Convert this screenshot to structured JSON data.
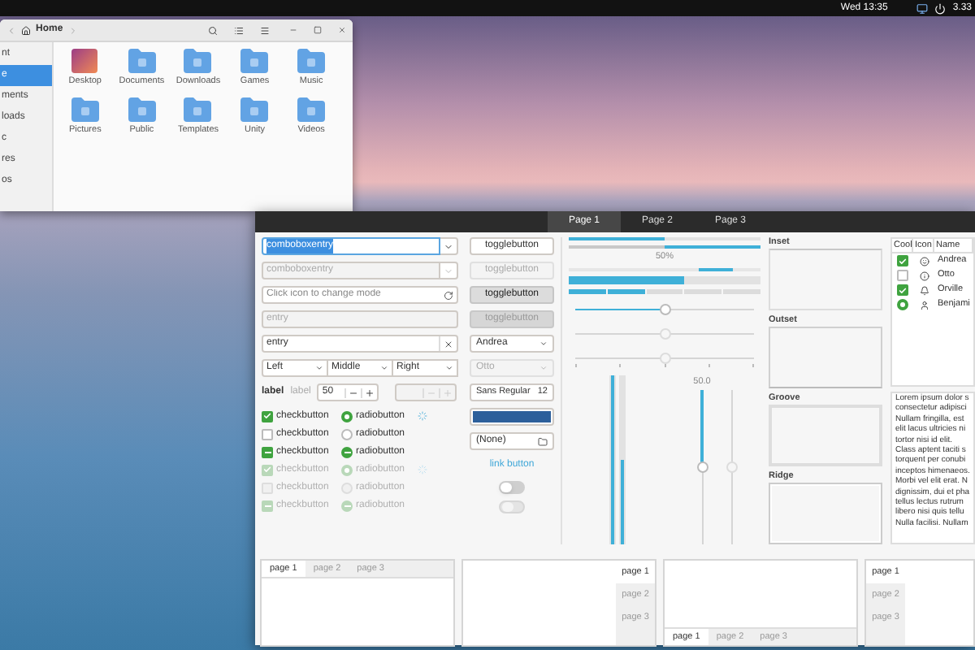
{
  "top_bar": {
    "clock": "Wed 13:35",
    "battery": "3.33"
  },
  "file_manager": {
    "title": "Home",
    "sidebar": [
      {
        "label": "nt",
        "selected": false
      },
      {
        "label": "e",
        "selected": true
      },
      {
        "label": "ments",
        "selected": false
      },
      {
        "label": "loads",
        "selected": false
      },
      {
        "label": "c",
        "selected": false
      },
      {
        "label": "res",
        "selected": false
      },
      {
        "label": "os",
        "selected": false
      }
    ],
    "files": [
      {
        "name": "Desktop",
        "kind": "desktop"
      },
      {
        "name": "Documents",
        "kind": "folder"
      },
      {
        "name": "Downloads",
        "kind": "folder"
      },
      {
        "name": "Games",
        "kind": "folder"
      },
      {
        "name": "Music",
        "kind": "folder"
      },
      {
        "name": "Pictures",
        "kind": "folder"
      },
      {
        "name": "Public",
        "kind": "folder"
      },
      {
        "name": "Templates",
        "kind": "folder"
      },
      {
        "name": "Unity",
        "kind": "folder"
      },
      {
        "name": "Videos",
        "kind": "folder"
      }
    ]
  },
  "widget_factory": {
    "tabs": [
      {
        "label": "Page 1",
        "selected": true
      },
      {
        "label": "Page 2",
        "selected": false
      },
      {
        "label": "Page 3",
        "selected": false
      }
    ],
    "entries": [
      {
        "kind": "combo",
        "value": "comboboxentry",
        "disabled": false,
        "text_selected": true
      },
      {
        "kind": "combo",
        "value": "comboboxentry",
        "disabled": true,
        "text_selected": false
      },
      {
        "kind": "mode_entry",
        "placeholder": "Click icon to change mode",
        "disabled": false
      },
      {
        "kind": "entry",
        "value": "entry",
        "disabled": true
      },
      {
        "kind": "clear_entry",
        "value": "entry",
        "disabled": false
      }
    ],
    "dropdowns": [
      "Left",
      "Middle",
      "Right"
    ],
    "labels": [
      {
        "text": "label",
        "disabled": false
      },
      {
        "text": "label",
        "disabled": true
      }
    ],
    "spins": [
      {
        "value": "50",
        "disabled": false
      },
      {
        "disabled": true
      }
    ],
    "check_rows": [
      {
        "check": "checkbutton",
        "radio": "radiobutton",
        "checked": true,
        "inconsistent": false,
        "spinner": true,
        "disabled": false
      },
      {
        "check": "checkbutton",
        "radio": "radiobutton",
        "checked": false,
        "inconsistent": false,
        "spinner": false,
        "disabled": false
      },
      {
        "check": "checkbutton",
        "radio": "radiobutton",
        "checked": false,
        "inconsistent": true,
        "spinner": false,
        "disabled": false
      },
      {
        "check": "checkbutton",
        "radio": "radiobutton",
        "checked": true,
        "inconsistent": false,
        "spinner": true,
        "disabled": true
      },
      {
        "check": "checkbutton",
        "radio": "radiobutton",
        "checked": false,
        "inconsistent": false,
        "spinner": false,
        "disabled": true
      },
      {
        "check": "checkbutton",
        "radio": "radiobutton",
        "checked": false,
        "inconsistent": true,
        "spinner": false,
        "disabled": true
      }
    ],
    "toggle_buttons": [
      {
        "label": "togglebutton",
        "active": false,
        "disabled": false
      },
      {
        "label": "togglebutton",
        "active": false,
        "disabled": true
      },
      {
        "label": "togglebutton",
        "active": true,
        "disabled": false
      },
      {
        "label": "togglebutton",
        "active": true,
        "disabled": true
      }
    ],
    "combos": [
      {
        "value": "Andrea",
        "disabled": false
      },
      {
        "value": "Otto",
        "disabled": true
      }
    ],
    "font_button": {
      "family": "Sans Regular",
      "size": "12"
    },
    "color_button": {
      "color": "#2c5f9b"
    },
    "file_button": {
      "value": "(None)"
    },
    "link_button": "link button",
    "switches": [
      {
        "on": false,
        "disabled": false
      },
      {
        "on": false,
        "disabled": true
      }
    ],
    "progress": [
      {
        "kind": "bar",
        "level": 0.5,
        "inverted": false
      },
      {
        "kind": "bar",
        "level": 0.5,
        "inverted": true
      },
      {
        "kind": "label",
        "text": "50%"
      },
      {
        "kind": "activity"
      },
      {
        "kind": "bar",
        "level": 0.6,
        "inverted": false
      },
      {
        "kind": "segments",
        "level": 0.4
      }
    ],
    "sliders": [
      {
        "level": 0.5,
        "disabled": false,
        "marks": false
      },
      {
        "level": 0.5,
        "disabled": true,
        "marks": false
      },
      {
        "level": 0.5,
        "disabled": true,
        "marks": true
      }
    ],
    "vertical_bars": [
      {
        "level": 1
      },
      {
        "level": 0.5
      }
    ],
    "vertical_scales": [
      {
        "level": 0.5,
        "reading": "50.0",
        "disabled": false
      },
      {
        "level": 0.5,
        "disabled": true
      }
    ],
    "frames": [
      {
        "label": "Inset",
        "kind": "inset"
      },
      {
        "label": "Outset",
        "kind": "outset"
      },
      {
        "label": "Groove",
        "kind": "groove"
      },
      {
        "label": "Ridge",
        "kind": "ridge"
      }
    ],
    "tree": {
      "columns": [
        "Cool",
        "Icon",
        "Name"
      ],
      "rows": [
        {
          "kind": "check",
          "checked": true,
          "name": "Andrea"
        },
        {
          "kind": "check",
          "checked": false,
          "name": "Otto"
        },
        {
          "kind": "check",
          "checked": true,
          "name": "Orville"
        },
        {
          "kind": "radio",
          "checked": true,
          "name": "Benjami"
        }
      ]
    },
    "text_view": [
      "Lorem ipsum dolor s",
      "consectetur adipisci",
      "Nullam fringilla, est",
      "elit lacus ultricies ni",
      "tortor nisi id elit.",
      "Class aptent taciti s",
      "torquent per conubi",
      "inceptos himenaeos.",
      "Morbi vel elit erat. N",
      "dignissim, dui et pha",
      "tellus lectus rutrum",
      "libero nisi quis tellu",
      "Nulla facilisi. Nullam"
    ],
    "notebooks": [
      {
        "kind": "top",
        "tabs": [
          {
            "label": "page 1",
            "selected": true
          },
          {
            "label": "page 2",
            "selected": false
          },
          {
            "label": "page 3",
            "selected": false
          }
        ]
      },
      {
        "kind": "right",
        "tabs": [
          {
            "label": "page 1",
            "selected": true
          },
          {
            "label": "page 2",
            "selected": false
          },
          {
            "label": "page 3",
            "selected": false
          }
        ]
      },
      {
        "kind": "bottom",
        "tabs": [
          {
            "label": "page 1",
            "selected": true
          },
          {
            "label": "page 2",
            "selected": false
          },
          {
            "label": "page 3",
            "selected": false
          }
        ]
      },
      {
        "kind": "left",
        "tabs": [
          {
            "label": "page 1",
            "selected": true
          },
          {
            "label": "page 2",
            "selected": false
          },
          {
            "label": "page 3",
            "selected": false
          }
        ]
      }
    ]
  }
}
